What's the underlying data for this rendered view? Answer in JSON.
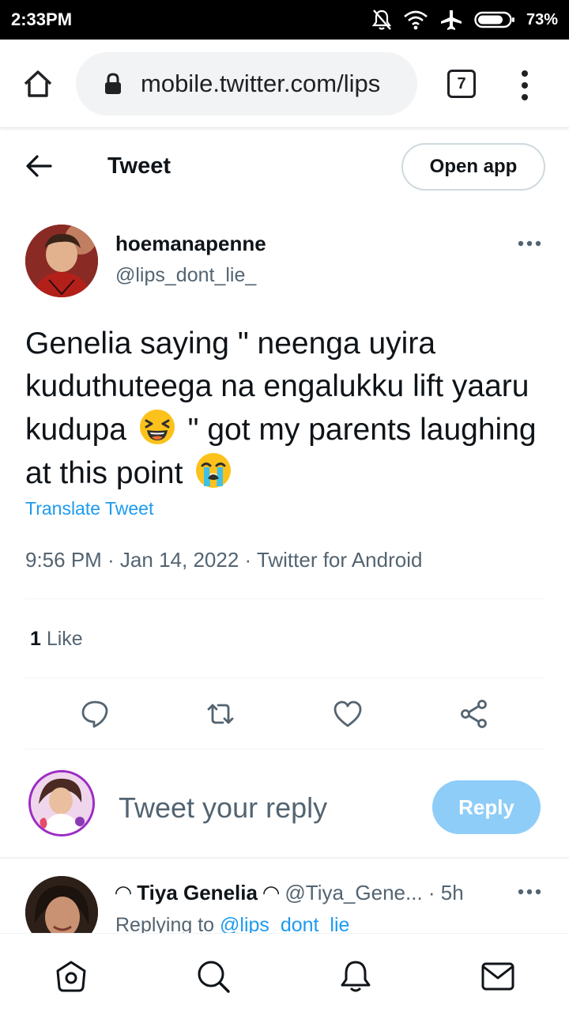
{
  "status_bar": {
    "time": "2:33PM",
    "battery": "73%"
  },
  "browser": {
    "url": "mobile.twitter.com/lips",
    "tab_count": "7"
  },
  "header": {
    "title": "Tweet",
    "open_app_label": "Open app"
  },
  "tweet": {
    "display_name": "hoemanapenne",
    "handle": "@lips_dont_lie_",
    "text_part1": "Genelia saying \" neenga uyira kuduthuteega na engalukku lift yaaru kudupa",
    "text_part2": " \" got my parents laughing at this point",
    "translate_label": "Translate Tweet",
    "meta": "9:56 PM · Jan 14, 2022 · Twitter for Android",
    "like_count": "1",
    "like_label": " Like"
  },
  "composer": {
    "placeholder": "Tweet your reply",
    "reply_label": "Reply"
  },
  "reply_item": {
    "name": "◠ Tiya Genelia ◠",
    "handle_time": " @Tiya_Gene... · 5h",
    "replying_prefix": "Replying to ",
    "replying_handle": "@lips_dont_lie_"
  },
  "icons": {
    "reply": "comment-icon",
    "retweet": "retweet-icon",
    "like": "heart-icon",
    "share": "share-icon",
    "home": "home-icon",
    "search": "search-icon",
    "notifications": "bell-icon",
    "messages": "mail-icon"
  },
  "colors": {
    "link": "#1d9bf0",
    "reply_button": "#8ecdf8",
    "secondary_text": "#536471"
  }
}
